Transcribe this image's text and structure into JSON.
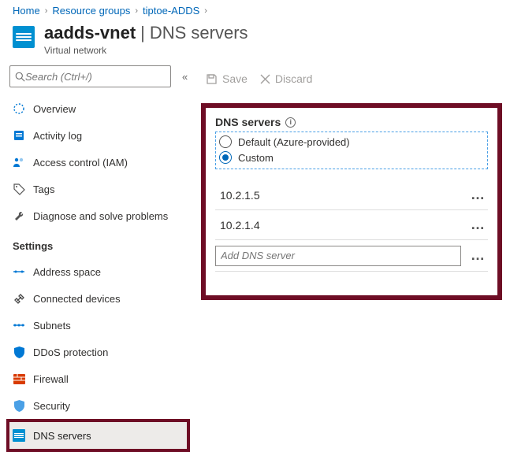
{
  "breadcrumb": [
    "Home",
    "Resource groups",
    "tiptoe-ADDS"
  ],
  "title": {
    "resource": "aadds-vnet",
    "section": "DNS servers",
    "subtitle": "Virtual network"
  },
  "sidebar": {
    "search_placeholder": "Search (Ctrl+/)",
    "top": [
      {
        "label": "Overview"
      },
      {
        "label": "Activity log"
      },
      {
        "label": "Access control (IAM)"
      },
      {
        "label": "Tags"
      },
      {
        "label": "Diagnose and solve problems"
      }
    ],
    "settings_header": "Settings",
    "settings": [
      {
        "label": "Address space"
      },
      {
        "label": "Connected devices"
      },
      {
        "label": "Subnets"
      },
      {
        "label": "DDoS protection"
      },
      {
        "label": "Firewall"
      },
      {
        "label": "Security"
      },
      {
        "label": "DNS servers"
      }
    ]
  },
  "commands": {
    "save": "Save",
    "discard": "Discard"
  },
  "panel": {
    "heading": "DNS servers",
    "options": {
      "default": "Default (Azure-provided)",
      "custom": "Custom"
    },
    "selected": "custom",
    "servers": [
      "10.2.1.5",
      "10.2.1.4"
    ],
    "add_placeholder": "Add DNS server"
  }
}
